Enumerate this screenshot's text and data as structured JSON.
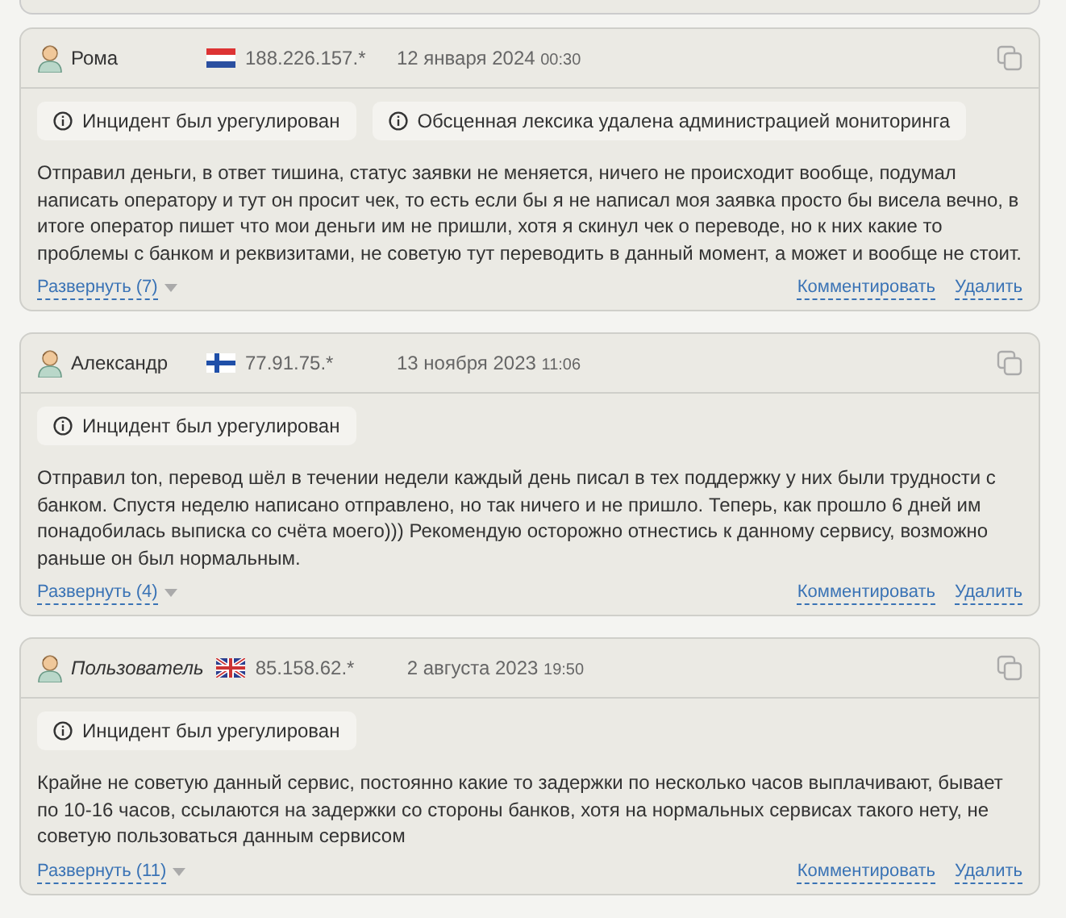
{
  "reviews": [
    {
      "author": "Рома",
      "anonymous": false,
      "kind": "nl",
      "ip": "188.226.157.*",
      "date": "12 января 2024",
      "time": "00:30",
      "notices": [
        "Инцидент был урегулирован",
        "Обсценная лексика удалена администрацией мониторинга"
      ],
      "text": "Отправил деньги, в ответ тишина, статус заявки не меняется, ничего не происходит вообще, подумал написать оператору и тут он просит чек, то есть если бы я не написал моя заявка просто бы висела вечно, в итоге оператор пишет что мои деньги им не пришли, хотя я скинул чек о переводе, но к них какие то проблемы с банком и реквизитами, не советую тут переводить в данный момент, а может и вообще не стоит.",
      "expand": "Развернуть (7)",
      "comment": "Комментировать",
      "delete": "Удалить"
    },
    {
      "author": "Александр",
      "anonymous": false,
      "kind": "fi",
      "ip": "77.91.75.*",
      "date": "13 ноября 2023",
      "time": "11:06",
      "notices": [
        "Инцидент был урегулирован"
      ],
      "text": "Отправил ton, перевод шёл в течении недели каждый день писал в тех поддержку у них были трудности с банком. Спустя неделю написано отправлено, но так ничего и не пришло. Теперь, как прошло 6 дней им понадобилась выписка со счёта моего))) Рекомендую осторожно отнестись к данному сервису, возможно раньше он был нормальным.",
      "expand": "Развернуть (4)",
      "comment": "Комментировать",
      "delete": "Удалить"
    },
    {
      "author": "Пользователь",
      "anonymous": true,
      "kind": "gb",
      "ip": "85.158.62.*",
      "date": "2 августа 2023",
      "time": "19:50",
      "notices": [
        "Инцидент был урегулирован"
      ],
      "text": "Крайне не советую данный сервис, постоянно какие то задержки по несколько часов выплачивают, бывает по 10-16 часов, ссылаются на задержки со стороны банков, хотя на нормальных сервисах такого нету, не советую пользоваться данным сервисом",
      "expand": "Развернуть (11)",
      "comment": "Комментировать",
      "delete": "Удалить"
    }
  ]
}
